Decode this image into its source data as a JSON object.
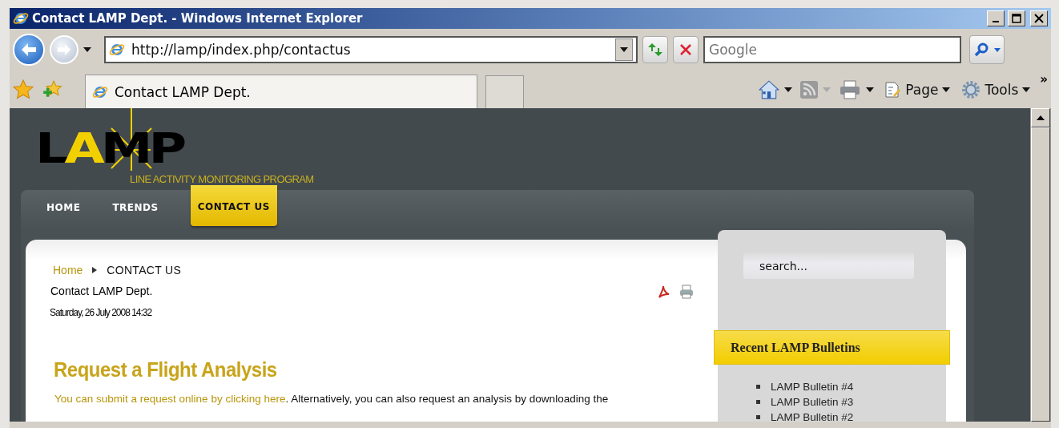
{
  "window": {
    "title": "Contact LAMP Dept. - Windows Internet Explorer"
  },
  "address_bar": {
    "url": "http://lamp/index.php/contactus"
  },
  "search": {
    "placeholder": "Google"
  },
  "tabs": [
    {
      "label": "Contact LAMP Dept.",
      "selected": true
    }
  ],
  "command_bar": [
    {
      "label": "Page"
    },
    {
      "label": "Tools"
    }
  ],
  "toolbar_overflow": "»",
  "site": {
    "logo_text": "LAMP",
    "logo_subtitle": "LINE ACTIVITY MONITORING PROGRAM",
    "nav": [
      {
        "label": "HOME",
        "selected": false
      },
      {
        "label": "TRENDS",
        "selected": false
      },
      {
        "label": "CONTACT US",
        "selected": true
      }
    ]
  },
  "breadcrumb": [
    {
      "label": "Home",
      "kind": "link"
    },
    {
      "label": "CONTACT US",
      "kind": "current"
    }
  ],
  "article": {
    "page_title": "Contact LAMP Dept.",
    "date": "Saturday, 26 July 2008 14:32",
    "heading": "Request a Flight Analysis",
    "link_text": "You can submit a request online by clicking here",
    "body": ". Alternatively, you can also request an analysis by downloading the"
  },
  "sidebar": {
    "search_placeholder": "search...",
    "module_title": "Recent LAMP Bulletins",
    "items": [
      "LAMP Bulletin #4",
      "LAMP Bulletin #3",
      "LAMP Bulletin #2"
    ]
  }
}
